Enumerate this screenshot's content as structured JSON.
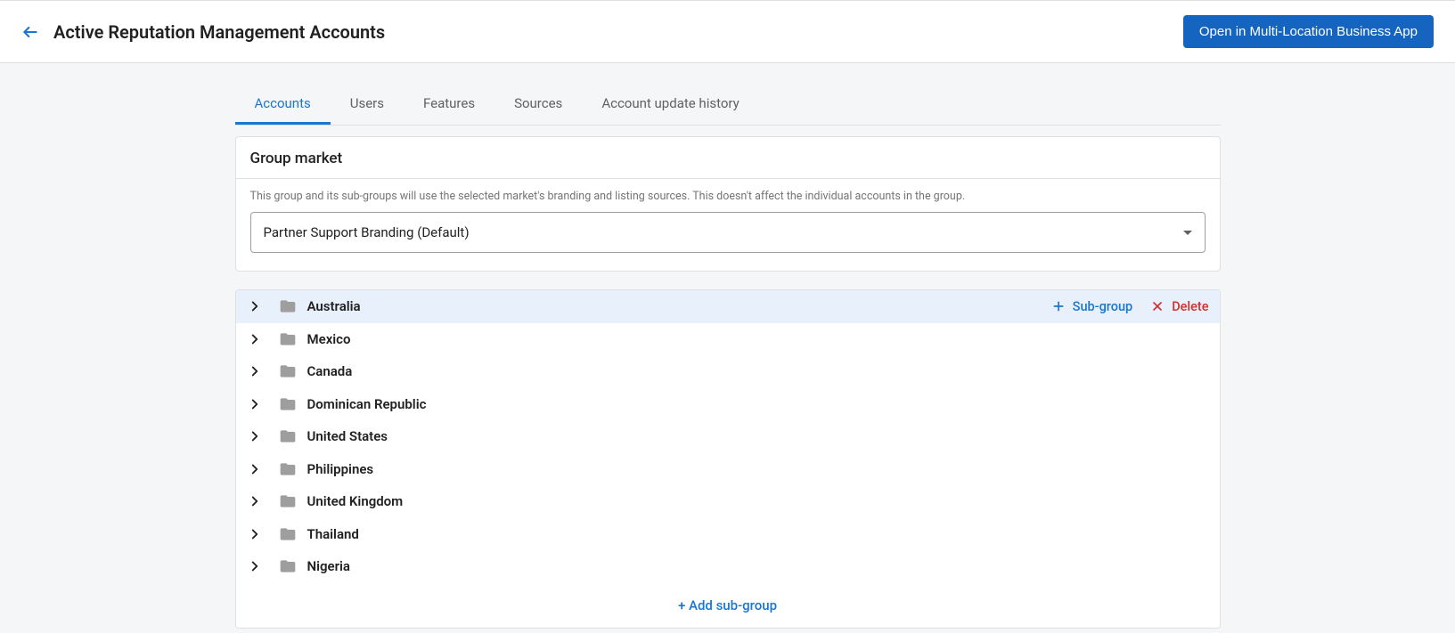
{
  "header": {
    "title": "Active Reputation Management Accounts",
    "open_button": "Open in Multi-Location Business App"
  },
  "tabs": [
    {
      "label": "Accounts",
      "active": true
    },
    {
      "label": "Users",
      "active": false
    },
    {
      "label": "Features",
      "active": false
    },
    {
      "label": "Sources",
      "active": false
    },
    {
      "label": "Account update history",
      "active": false
    }
  ],
  "group_market": {
    "title": "Group market",
    "help": "This group and its sub-groups will use the selected market's branding and listing sources. This doesn't affect the individual accounts in the group.",
    "selected": "Partner Support Branding (Default)"
  },
  "tree": {
    "items": [
      {
        "label": "Australia",
        "highlighted": true
      },
      {
        "label": "Mexico",
        "highlighted": false
      },
      {
        "label": "Canada",
        "highlighted": false
      },
      {
        "label": "Dominican Republic",
        "highlighted": false
      },
      {
        "label": "United States",
        "highlighted": false
      },
      {
        "label": "Philippines",
        "highlighted": false
      },
      {
        "label": "United Kingdom",
        "highlighted": false
      },
      {
        "label": "Thailand",
        "highlighted": false
      },
      {
        "label": "Nigeria",
        "highlighted": false
      }
    ],
    "row_actions": {
      "subgroup": "Sub-group",
      "delete": "Delete"
    },
    "add_subgroup": "+ Add sub-group"
  }
}
